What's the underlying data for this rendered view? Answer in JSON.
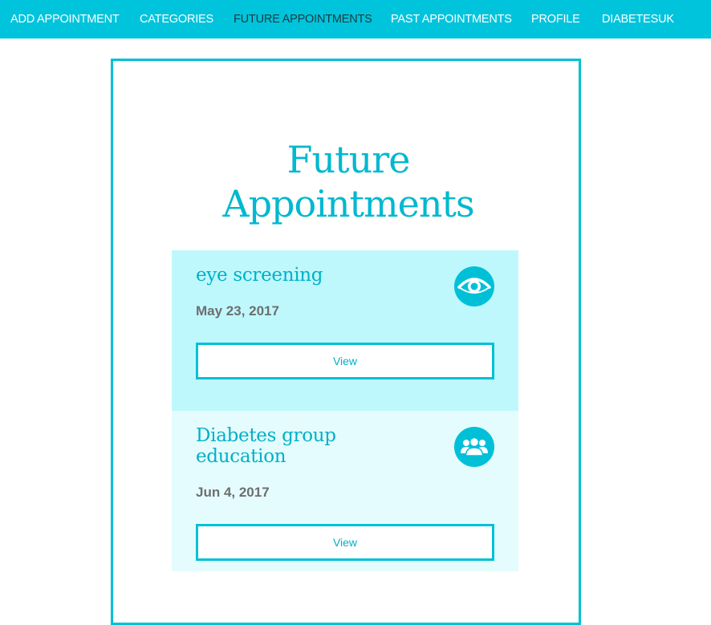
{
  "nav": {
    "items": [
      {
        "label": "ADD APPOINTMENT"
      },
      {
        "label": "CATEGORIES"
      },
      {
        "label": "FUTURE APPOINTMENTS",
        "active": true
      },
      {
        "label": "PAST APPOINTMENTS"
      },
      {
        "label": "PROFILE"
      },
      {
        "label": "DIABETESUK"
      }
    ]
  },
  "page": {
    "title_line1": "Future",
    "title_line2": "Appointments"
  },
  "appointments": [
    {
      "title": "eye screening",
      "date": "May 23, 2017",
      "icon": "eye-icon",
      "button_label": "View"
    },
    {
      "title": "Diabetes group education",
      "date": "Jun 4, 2017",
      "icon": "group-icon",
      "button_label": "View"
    }
  ],
  "colors": {
    "accent": "#00c4dc",
    "card_primary": "#bff8fc",
    "card_secondary": "#e4fcfd",
    "date_text": "#6e6e6e"
  }
}
